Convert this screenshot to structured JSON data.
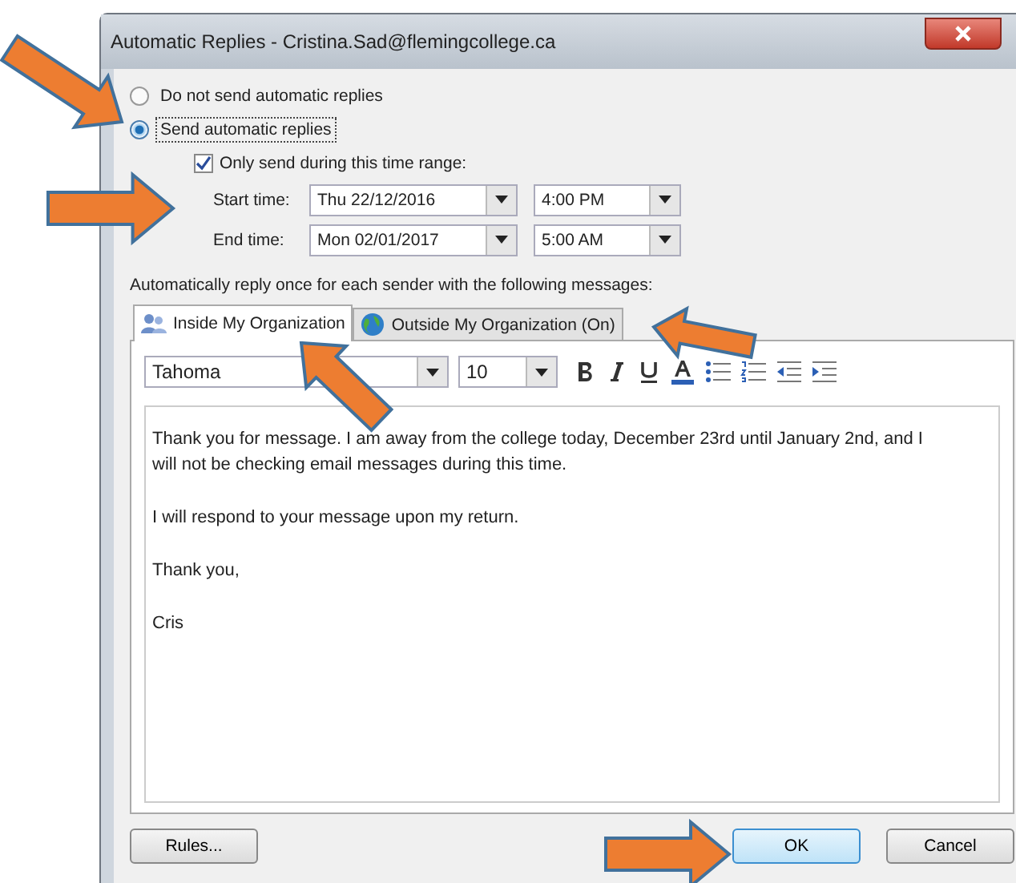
{
  "window": {
    "title": "Automatic Replies - Cristina.Sad@flemingcollege.ca"
  },
  "reply_options": [
    {
      "label": "Do not send automatic replies",
      "selected": false
    },
    {
      "label": "Send automatic replies",
      "selected": true
    }
  ],
  "time_range": {
    "label": "Only send during this time range:",
    "checked": true,
    "rows": [
      {
        "label": "Start time:",
        "date": "Thu 22/12/2016",
        "time": "4:00 PM"
      },
      {
        "label": "End time:",
        "date": "Mon 02/01/2017",
        "time": "5:00 AM"
      }
    ]
  },
  "instruction": "Automatically reply once for each sender with the following messages:",
  "tabs": [
    {
      "label": "Inside My Organization",
      "selected": true,
      "kind": "people"
    },
    {
      "label": "Outside My Organization (On)",
      "selected": false,
      "kind": "globe"
    }
  ],
  "toolbar": {
    "font": "Tahoma",
    "size": "10"
  },
  "message": [
    "Thank you for message. I am away from the college today, December 23rd until January 2nd, and I will not be checking email messages during this time.",
    "I will respond to your message upon my return.",
    "Thank you,",
    "Cris"
  ],
  "buttons": [
    {
      "label": "Rules...",
      "default": false
    },
    {
      "label": "OK",
      "default": true
    },
    {
      "label": "Cancel",
      "default": false
    }
  ]
}
